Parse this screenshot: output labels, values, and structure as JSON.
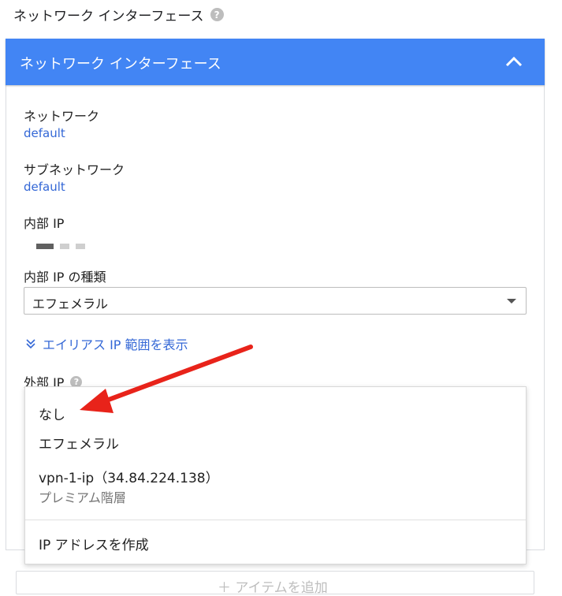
{
  "section": {
    "title": "ネットワーク インターフェース",
    "help_icon": "help-circle-icon"
  },
  "panel": {
    "header_title": "ネットワーク インターフェース",
    "collapse_icon": "chevron-up-icon",
    "header_color": "#4285f4"
  },
  "network": {
    "label": "ネットワーク",
    "value": "default"
  },
  "subnetwork": {
    "label": "サブネットワーク",
    "value": "default"
  },
  "internal_ip": {
    "label": "内部 IP",
    "value_masked": true
  },
  "internal_ip_type": {
    "label": "内部 IP の種類",
    "selected": "エフェメラル"
  },
  "alias": {
    "link_label": "エイリアス IP 範囲を表示",
    "icon": "double-chevron-down-icon"
  },
  "external_ip": {
    "label": "外部 IP",
    "help_icon": "help-circle-icon",
    "options": [
      {
        "label": "なし"
      },
      {
        "label": "エフェメラル"
      },
      {
        "label": "vpn-1-ip（34.84.224.138）",
        "sublabel": "プレミアム階層"
      }
    ],
    "create_label": "IP アドレスを作成"
  },
  "add_item": {
    "label": "＋ アイテムを追加"
  },
  "annotation": {
    "color": "#e8231a"
  },
  "link_color": "#3367d6"
}
